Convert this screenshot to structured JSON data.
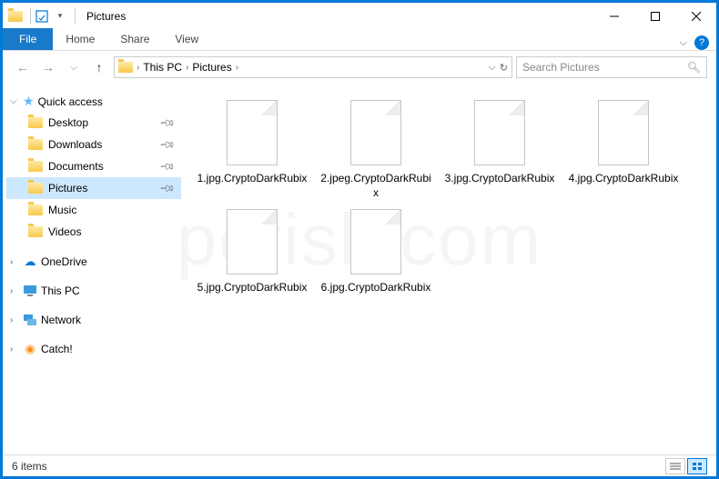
{
  "window": {
    "title": "Pictures"
  },
  "ribbon": {
    "file": "File",
    "tabs": [
      "Home",
      "Share",
      "View"
    ]
  },
  "breadcrumb": {
    "root": "This PC",
    "current": "Pictures"
  },
  "search": {
    "placeholder": "Search Pictures"
  },
  "nav": {
    "quick": {
      "label": "Quick access",
      "items": [
        {
          "label": "Desktop",
          "pinned": true
        },
        {
          "label": "Downloads",
          "pinned": true
        },
        {
          "label": "Documents",
          "pinned": true
        },
        {
          "label": "Pictures",
          "pinned": true,
          "selected": true
        },
        {
          "label": "Music",
          "pinned": false
        },
        {
          "label": "Videos",
          "pinned": false
        }
      ]
    },
    "roots": [
      {
        "label": "OneDrive",
        "icon": "cloud"
      },
      {
        "label": "This PC",
        "icon": "pc"
      },
      {
        "label": "Network",
        "icon": "network"
      },
      {
        "label": "Catch!",
        "icon": "catch"
      }
    ]
  },
  "files": [
    {
      "name": "1.jpg.CryptoDarkRubix"
    },
    {
      "name": "2.jpeg.CryptoDarkRubix"
    },
    {
      "name": "3.jpg.CryptoDarkRubix"
    },
    {
      "name": "4.jpg.CryptoDarkRubix"
    },
    {
      "name": "5.jpg.CryptoDarkRubix"
    },
    {
      "name": "6.jpg.CryptoDarkRubix"
    }
  ],
  "status": {
    "count": "6 items"
  }
}
